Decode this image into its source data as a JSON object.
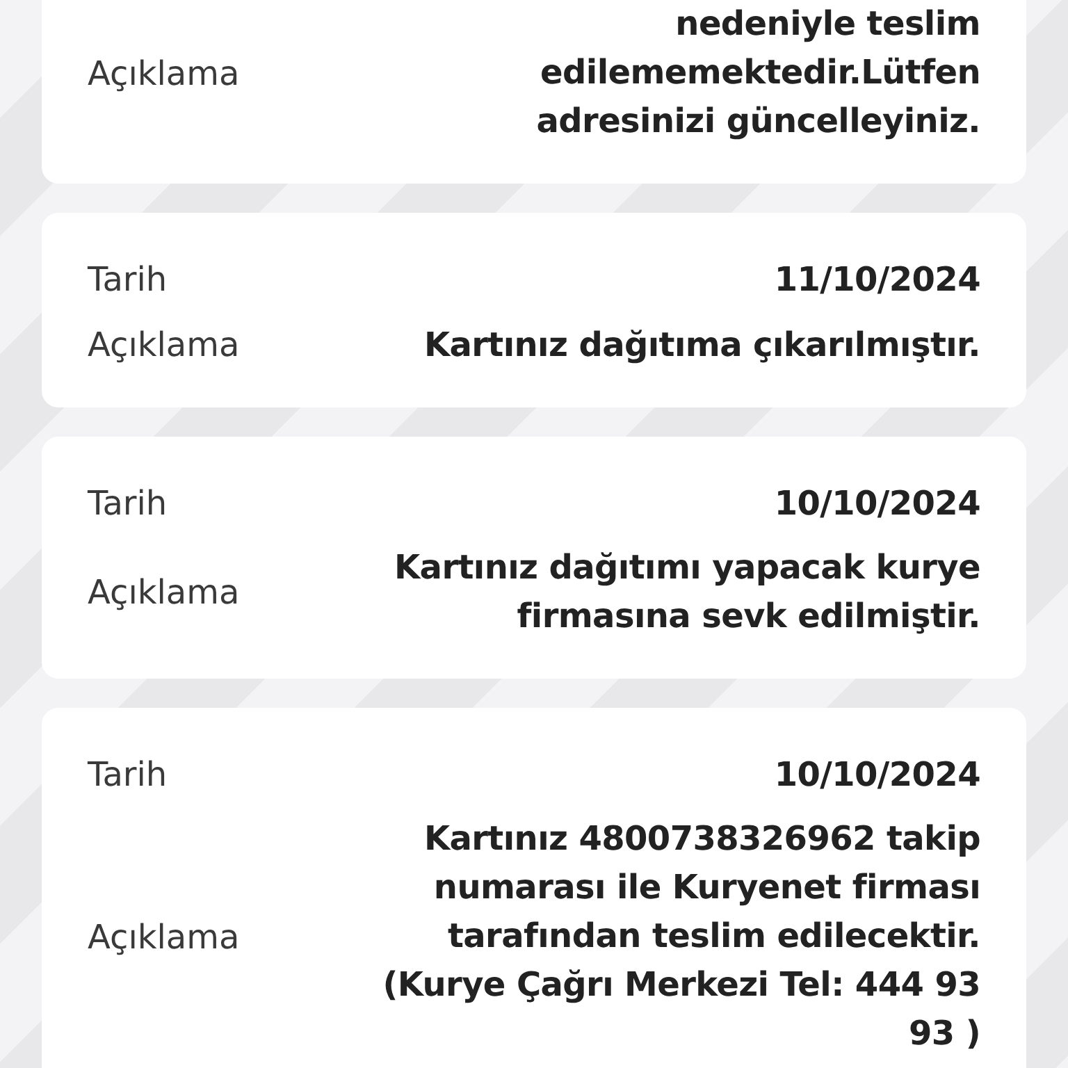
{
  "entries": [
    {
      "fields": [
        {
          "label": "Açıklama",
          "lines": [
            "nedeniyle teslim",
            "edilememektedir.Lütfen",
            "adresinizi güncelleyiniz."
          ]
        }
      ]
    },
    {
      "fields": [
        {
          "label": "Tarih",
          "lines": [
            "11/10/2024"
          ]
        },
        {
          "label": "Açıklama",
          "lines": [
            "Kartınız dağıtıma çıkarılmıştır."
          ]
        }
      ]
    },
    {
      "fields": [
        {
          "label": "Tarih",
          "lines": [
            "10/10/2024"
          ]
        },
        {
          "label": "Açıklama",
          "lines": [
            "Kartınız dağıtımı yapacak kurye",
            "firmasına sevk edilmiştir."
          ]
        }
      ]
    },
    {
      "fields": [
        {
          "label": "Tarih",
          "lines": [
            "10/10/2024"
          ]
        },
        {
          "label": "Açıklama",
          "lines": [
            "Kartınız 4800738326962 takip",
            "numarası ile Kuryenet firması",
            "tarafından teslim edilecektir.",
            "(Kurye Çağrı Merkezi Tel: 444 93",
            "93 )"
          ]
        }
      ]
    }
  ]
}
